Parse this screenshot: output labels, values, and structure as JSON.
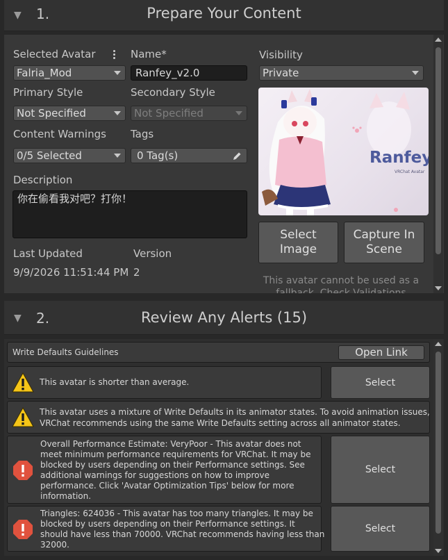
{
  "section1": {
    "number": "1.",
    "title": "Prepare Your Content",
    "selected_avatar_label": "Selected Avatar",
    "selected_avatar_value": "Falria_Mod",
    "name_label": "Name*",
    "name_value": "Ranfey_v2.0",
    "visibility_label": "Visibility",
    "visibility_value": "Private",
    "primary_style_label": "Primary Style",
    "primary_style_value": "Not Specified",
    "secondary_style_label": "Secondary Style",
    "secondary_style_value": "Not Specified",
    "content_warnings_label": "Content Warnings",
    "content_warnings_value": "0/5 Selected",
    "tags_label": "Tags",
    "tags_value": "0 Tag(s)",
    "description_label": "Description",
    "description_value": "你在偷看我对吧？打你！",
    "last_updated_label": "Last Updated",
    "last_updated_value": "9/9/2026 11:51:44 PM",
    "version_label": "Version",
    "version_value": "2",
    "thumbnail": {
      "title": "Ranfey",
      "subtitle": "VRChat Avatar"
    },
    "select_image_line1": "Select",
    "select_image_line2": "Image",
    "capture_line1": "Capture In",
    "capture_line2": "Scene",
    "fallback_note_line1": "This avatar cannot be used as a",
    "fallback_note_line2": "fallback. Check Validations"
  },
  "section2": {
    "number": "2.",
    "title": "Review Any Alerts (15)",
    "guidelines_text": "Write Defaults Guidelines",
    "open_link_label": "Open Link",
    "alerts": [
      {
        "type": "warning",
        "lines": [
          "This avatar is shorter than average."
        ],
        "button": "Select"
      },
      {
        "type": "warning",
        "lines": [
          "This avatar uses a mixture of Write Defaults in its animator states. To avoid animation issues,",
          "VRChat recommends using the same Write Defaults setting across all animator states."
        ],
        "button": ""
      },
      {
        "type": "error",
        "lines": [
          "Overall Performance Estimate: VeryPoor - This avatar does not",
          "meet minimum performance requirements for VRChat. It may be",
          "blocked by users depending on their Performance settings. See",
          "additional warnings for suggestions on how to improve",
          "performance. Click 'Avatar Optimization Tips' below for more",
          "information."
        ],
        "button": "Select"
      },
      {
        "type": "error",
        "lines": [
          "Triangles: 624036 - This avatar has too many triangles. It may be",
          "blocked by users depending on their Performance settings. It",
          "should have less than 70000. VRChat recommends having less than",
          "32000."
        ],
        "button": "Select"
      }
    ]
  },
  "colors": {
    "background": "#282828",
    "panel": "#383838",
    "button": "#585858",
    "warning": "#f5c518",
    "error": "#e0523e"
  },
  "icons": [
    "more-vertical-icon",
    "pencil-icon",
    "warning-icon",
    "error-icon",
    "triangle-down-icon"
  ]
}
